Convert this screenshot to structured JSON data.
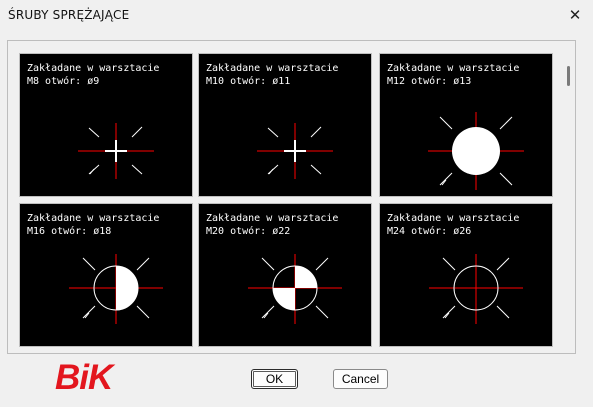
{
  "window": {
    "title": "ŚRUBY SPRĘŻAJĄCE",
    "close_icon": "close-icon"
  },
  "tiles": [
    {
      "line1": "Zakładane w warsztacie",
      "line2": "M8 otwór: ø9",
      "symbol": "cross"
    },
    {
      "line1": "Zakładane w warsztacie",
      "line2": "M10 otwór: ø11",
      "symbol": "cross"
    },
    {
      "line1": "Zakładane w warsztacie",
      "line2": "M12 otwór: ø13",
      "symbol": "filled-circle"
    },
    {
      "line1": "Zakładane w warsztacie",
      "line2": "M16 otwór: ø18",
      "symbol": "half-circle"
    },
    {
      "line1": "Zakładane w warsztacie",
      "line2": "M20 otwór: ø22",
      "symbol": "checker-circle"
    },
    {
      "line1": "Zakładane w warsztacie",
      "line2": "M24 otwór: ø26",
      "symbol": "open-circle"
    }
  ],
  "buttons": {
    "ok": "OK",
    "cancel": "Cancel"
  },
  "logo": {
    "text": "BiK"
  },
  "colors": {
    "tile_bg": "#000000",
    "axis_red": "#ff0000",
    "symbol_white": "#ffffff",
    "logo_red": "#e3161e"
  }
}
